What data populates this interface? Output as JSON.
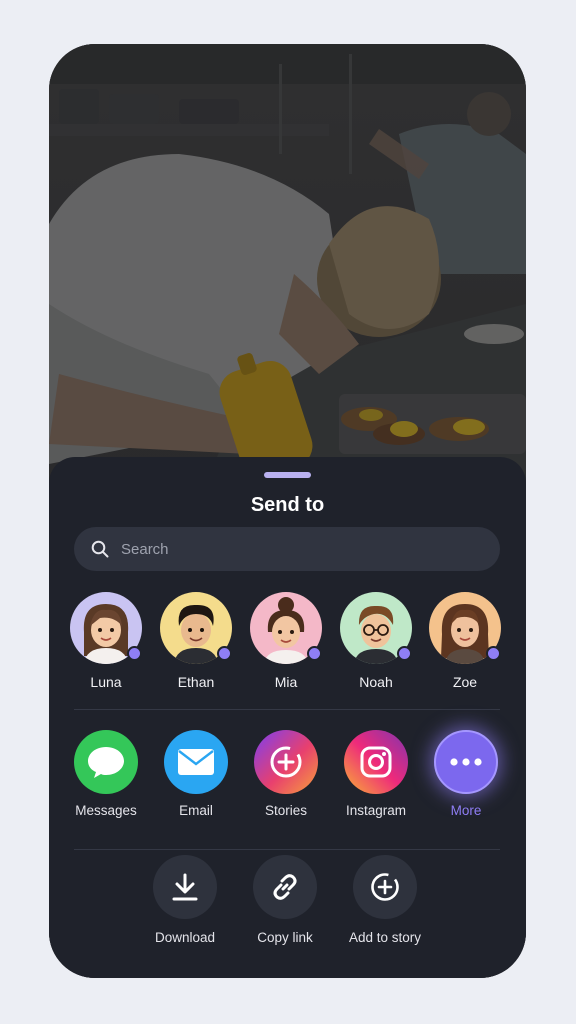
{
  "sheet": {
    "title": "Send to",
    "search": {
      "placeholder": "Search",
      "value": ""
    }
  },
  "contacts": [
    {
      "name": "Luna",
      "bg": "#c9c4f2",
      "online": true
    },
    {
      "name": "Ethan",
      "bg": "#f4dc8c",
      "online": true
    },
    {
      "name": "Mia",
      "bg": "#f4b8c8",
      "online": true
    },
    {
      "name": "Noah",
      "bg": "#bfe8c8",
      "online": true
    },
    {
      "name": "Zoe",
      "bg": "#f4c28c",
      "online": true
    }
  ],
  "apps": [
    {
      "label": "Messages",
      "icon": "speech-bubble-icon",
      "color": "#34c759"
    },
    {
      "label": "Email",
      "icon": "envelope-icon",
      "color": "#2aa6f2"
    },
    {
      "label": "Stories",
      "icon": "story-plus-icon",
      "color": "#e8406e"
    },
    {
      "label": "Instagram",
      "icon": "instagram-icon",
      "color": "#d6336c"
    },
    {
      "label": "More",
      "icon": "more-dots-icon",
      "color": "#8f7ef5"
    }
  ],
  "actions": [
    {
      "label": "Download",
      "icon": "download-icon"
    },
    {
      "label": "Copy link",
      "icon": "link-icon"
    },
    {
      "label": "Add to story",
      "icon": "add-story-icon"
    }
  ],
  "colors": {
    "accent": "#8f7ef5",
    "sheet": "#1f222b",
    "page": "#eceef4"
  }
}
